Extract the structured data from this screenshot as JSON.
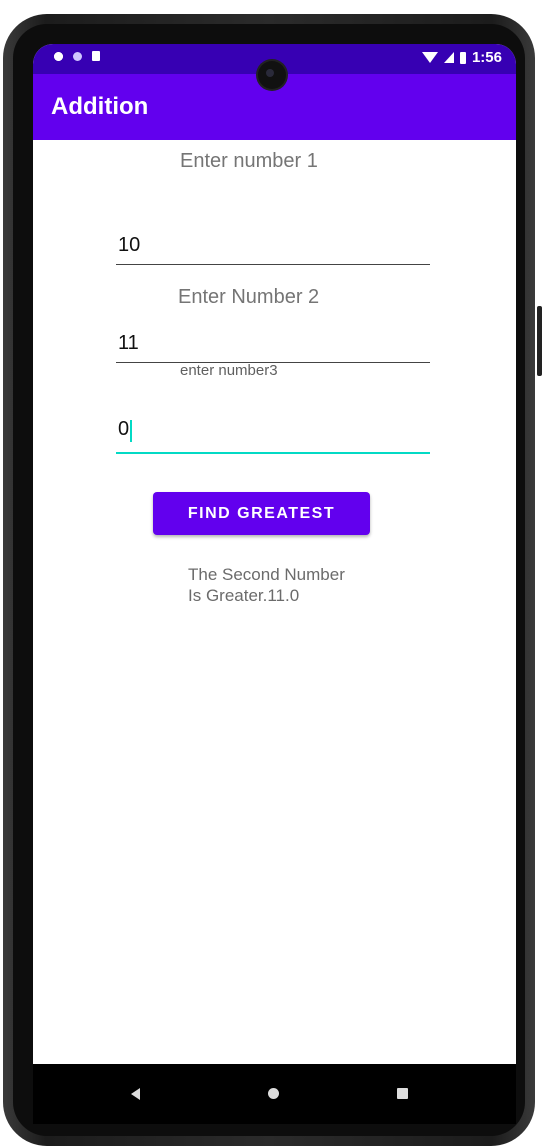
{
  "status_bar": {
    "time": "1:56"
  },
  "app_bar": {
    "title": "Addition"
  },
  "form": {
    "label1": "Enter number 1",
    "input1_value": "10",
    "label2": "Enter Number 2",
    "input2_value": "11",
    "label3": "enter number3",
    "input3_value": "0",
    "button_label": "FIND GREATEST",
    "result_line1": "The Second Number",
    "result_line2": "Is Greater.11.0"
  },
  "colors": {
    "accent": "#6200ee",
    "status_bar": "#3700b3",
    "focus": "#03dac5"
  }
}
